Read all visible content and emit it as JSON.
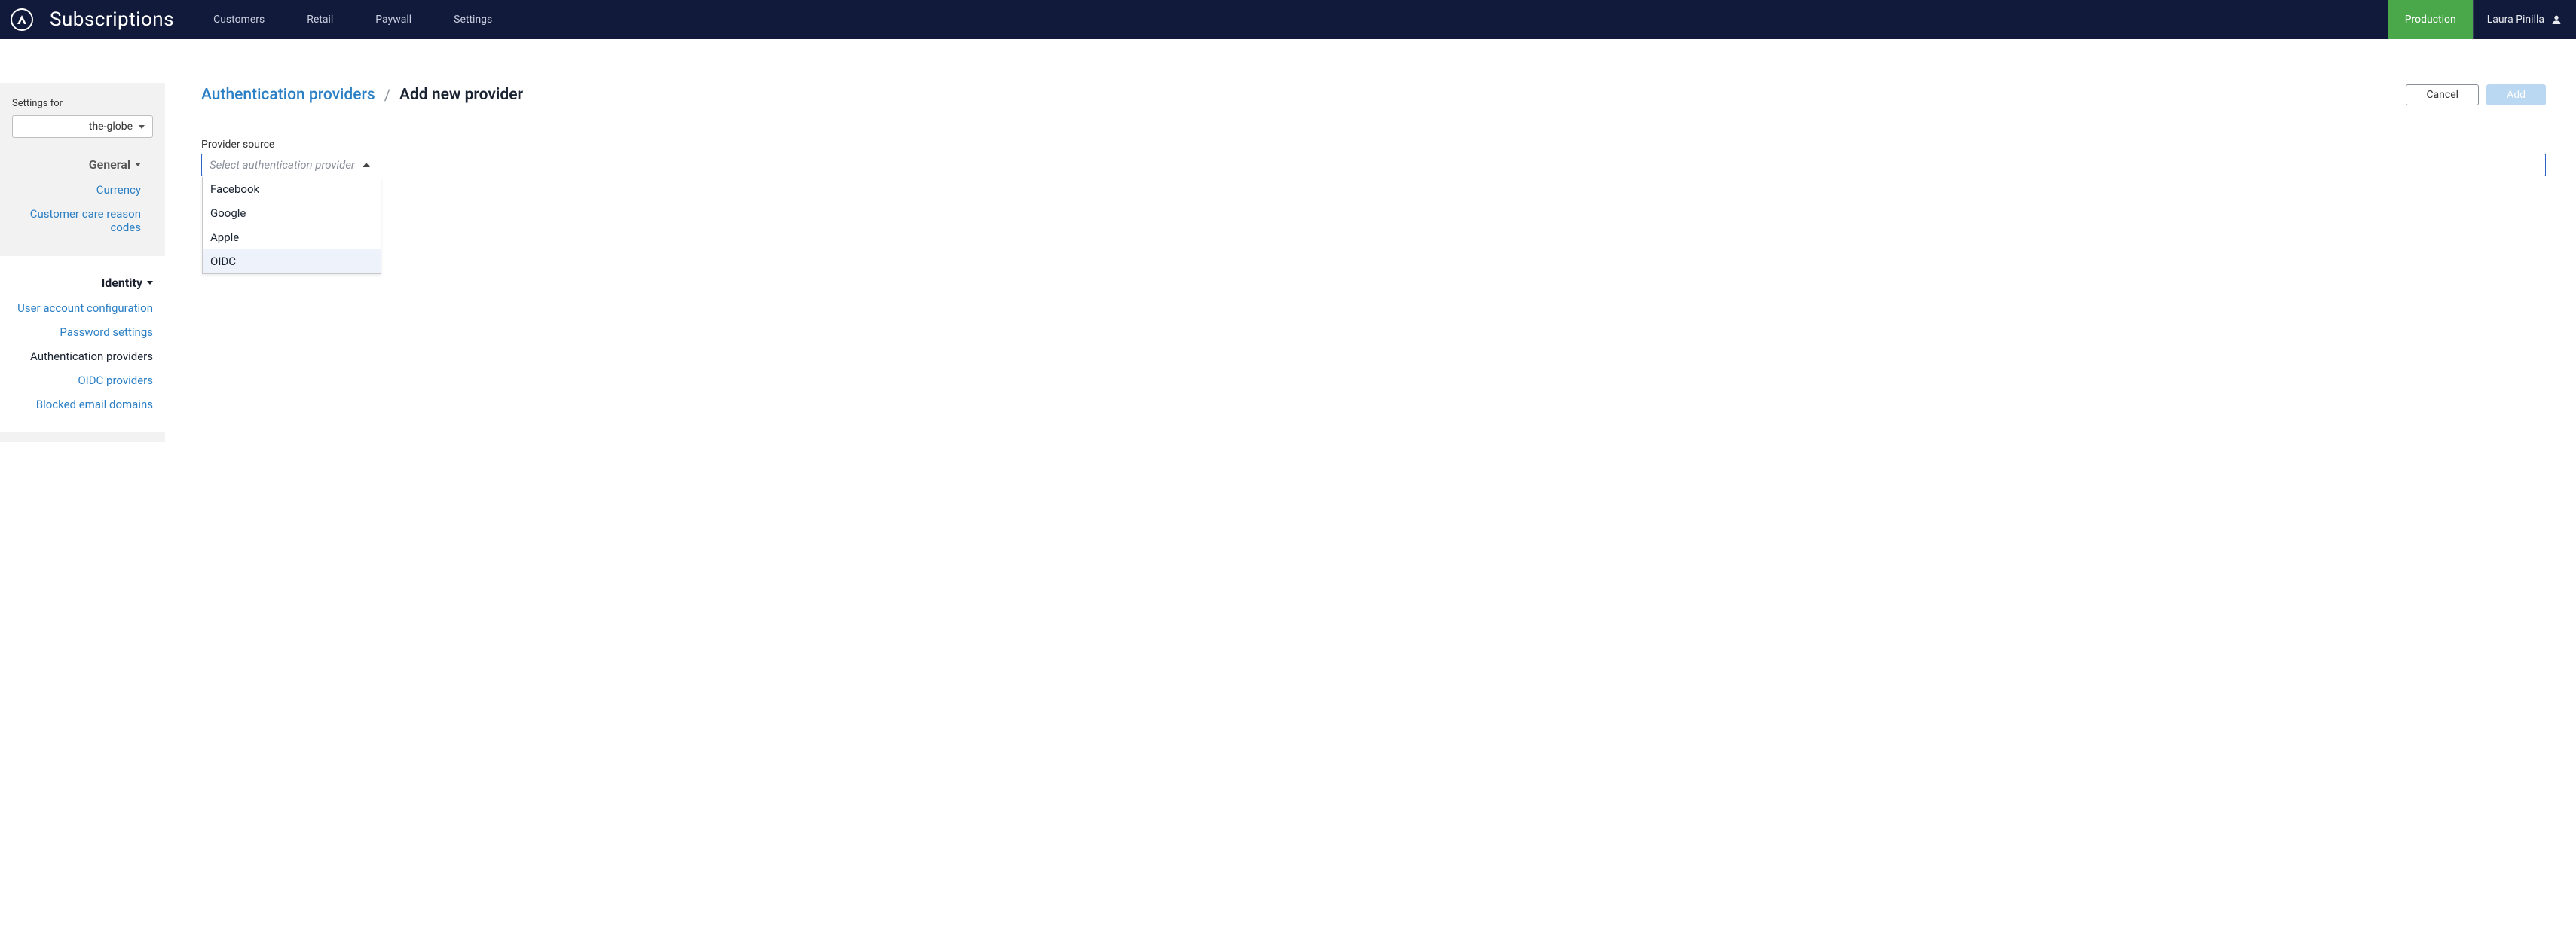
{
  "header": {
    "brand": "Subscriptions",
    "nav": [
      "Customers",
      "Retail",
      "Paywall",
      "Settings"
    ],
    "env": "Production",
    "user": "Laura Pinilla"
  },
  "sidebar": {
    "settings_for_label": "Settings for",
    "site": "the-globe",
    "groups": [
      {
        "title": "General",
        "active": false,
        "items": [
          {
            "label": "Currency",
            "active": false
          },
          {
            "label": "Customer care reason codes",
            "active": false
          }
        ]
      },
      {
        "title": "Identity",
        "active": true,
        "items": [
          {
            "label": "User account configuration",
            "active": false
          },
          {
            "label": "Password settings",
            "active": false
          },
          {
            "label": "Authentication providers",
            "active": true
          },
          {
            "label": "OIDC providers",
            "active": false
          },
          {
            "label": "Blocked email domains",
            "active": false
          }
        ]
      }
    ]
  },
  "page": {
    "breadcrumb_link": "Authentication providers",
    "breadcrumb_sep": "/",
    "breadcrumb_current": "Add new provider",
    "cancel_label": "Cancel",
    "add_label": "Add"
  },
  "form": {
    "provider_source_label": "Provider source",
    "placeholder": "Select authentication provider",
    "options": [
      "Facebook",
      "Google",
      "Apple",
      "OIDC"
    ],
    "highlighted_index": 3
  }
}
